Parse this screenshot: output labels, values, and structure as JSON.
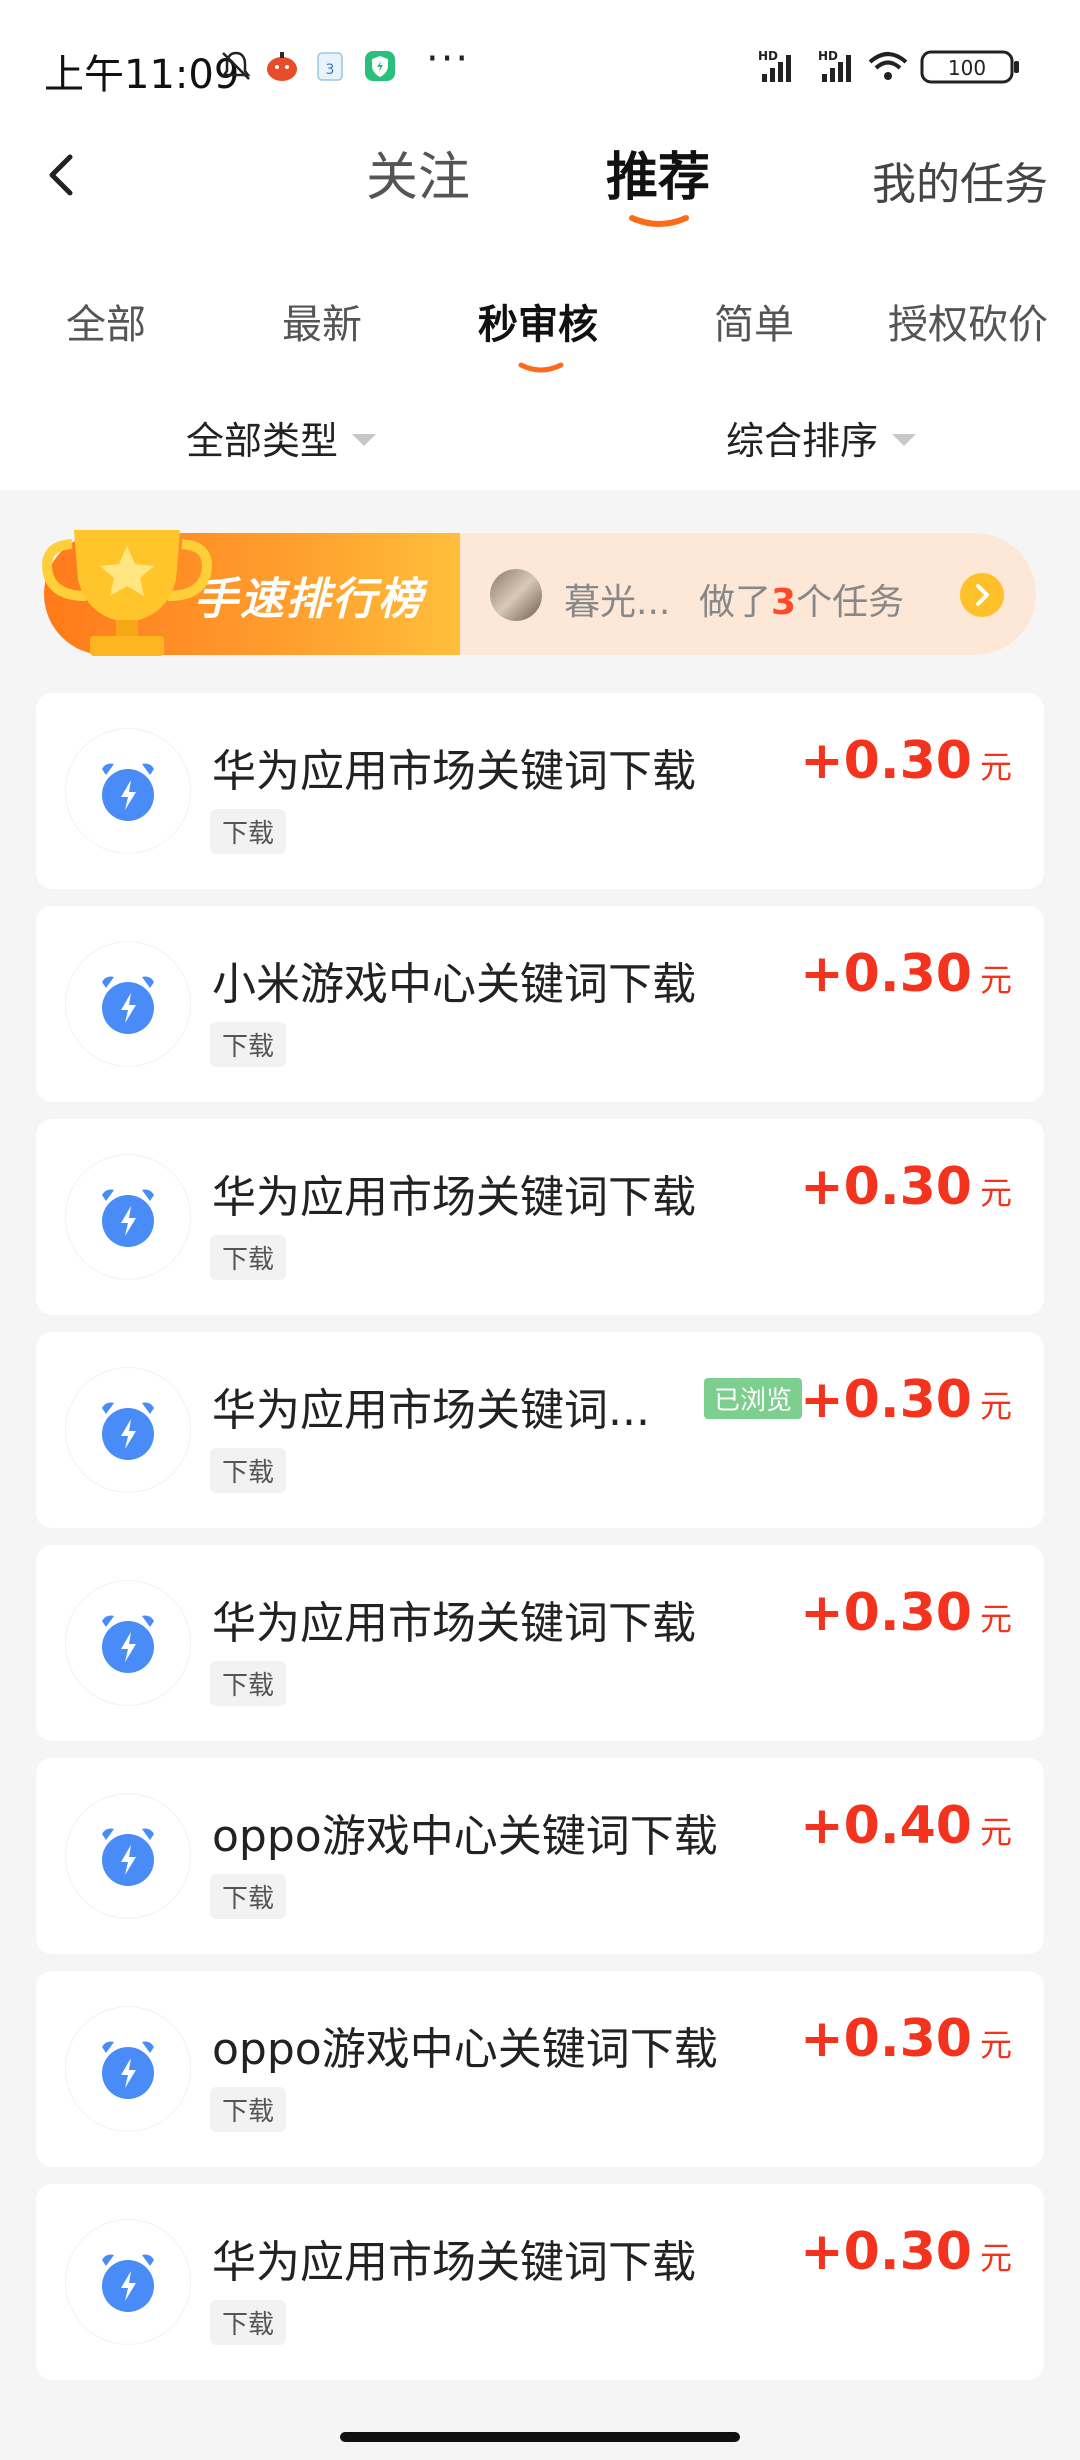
{
  "status_bar": {
    "time": "上午11:09",
    "more": "···",
    "battery": "100",
    "signal_labels": [
      "HD",
      "HD"
    ]
  },
  "header": {
    "tabs": [
      {
        "label": "关注",
        "active": false
      },
      {
        "label": "推荐",
        "active": true
      }
    ],
    "my_tasks": "我的任务",
    "accent_color": "#ff6a1a"
  },
  "sub_tabs": [
    {
      "label": "全部",
      "active": false
    },
    {
      "label": "最新",
      "active": false
    },
    {
      "label": "秒审核",
      "active": true
    },
    {
      "label": "简单",
      "active": false
    },
    {
      "label": "授权砍价",
      "active": false
    }
  ],
  "filters": {
    "type": "全部类型",
    "sort": "综合排序"
  },
  "rank_banner": {
    "title": "手速排行榜",
    "user": "暮光...",
    "did_prefix": "做了",
    "count": "3",
    "did_suffix": "个任务"
  },
  "tasks": [
    {
      "name": "华为应用市场关键词下载",
      "tag": "下载",
      "price": "+0.30",
      "unit": "元",
      "viewed": ""
    },
    {
      "name": "小米游戏中心关键词下载",
      "tag": "下载",
      "price": "+0.30",
      "unit": "元",
      "viewed": ""
    },
    {
      "name": "华为应用市场关键词下载",
      "tag": "下载",
      "price": "+0.30",
      "unit": "元",
      "viewed": ""
    },
    {
      "name": "华为应用市场关键词...",
      "tag": "下载",
      "price": "+0.30",
      "unit": "元",
      "viewed": "已浏览"
    },
    {
      "name": "华为应用市场关键词下载",
      "tag": "下载",
      "price": "+0.30",
      "unit": "元",
      "viewed": ""
    },
    {
      "name": "oppo游戏中心关键词下载",
      "tag": "下载",
      "price": "+0.40",
      "unit": "元",
      "viewed": ""
    },
    {
      "name": "oppo游戏中心关键词下载",
      "tag": "下载",
      "price": "+0.30",
      "unit": "元",
      "viewed": ""
    },
    {
      "name": "华为应用市场关键词下载",
      "tag": "下载",
      "price": "+0.30",
      "unit": "元",
      "viewed": ""
    }
  ],
  "colors": {
    "price": "#f4331e",
    "task_icon": "#4a8cf7",
    "viewed_badge": "#7ccf8e"
  }
}
